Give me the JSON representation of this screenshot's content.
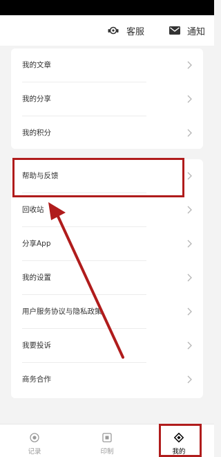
{
  "header": {
    "service_label": "客服",
    "notice_label": "通知"
  },
  "menu_group_1": [
    {
      "label": "我的文章"
    },
    {
      "label": "我的分享"
    },
    {
      "label": "我的积分"
    }
  ],
  "menu_group_2": [
    {
      "label": "帮助与反馈"
    },
    {
      "label": "回收站"
    },
    {
      "label": "分享App"
    },
    {
      "label": "我的设置"
    },
    {
      "label": "用户服务协议与隐私政策"
    },
    {
      "label": "我要投诉"
    },
    {
      "label": "商务合作"
    }
  ],
  "tabs": [
    {
      "label": "记录",
      "icon": "record-icon"
    },
    {
      "label": "印制",
      "icon": "print-icon"
    },
    {
      "label": "我的",
      "icon": "mine-icon",
      "active": true
    }
  ],
  "colors": {
    "highlight": "#b01c1c",
    "background": "#f3f3f3"
  }
}
